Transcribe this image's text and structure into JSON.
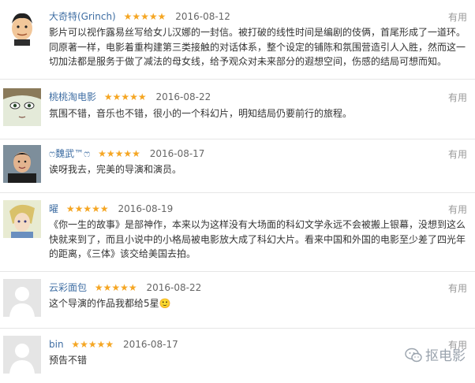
{
  "reviews": [
    {
      "username": "大奇特(Grinch)",
      "stars": "★★★★★",
      "date": "2016-08-12",
      "useful": "有用",
      "content": "影片可以视作露易丝写给女儿汉娜的一封信。被打破的线性时间是编剧的伎俩，首尾形成了一道环。同原著一样，电影着重构建第三类接触的对话体系，整个设定的铺陈和氛围营造引人入胜，然而这一切加法都是服务于做了减法的母女线，给予观众对未来部分的遐想空间，伤感的结局可想而知。"
    },
    {
      "username": "桃桃淘电影",
      "stars": "★★★★★",
      "date": "2016-08-22",
      "useful": "有用",
      "content": "氛围不错，音乐也不错，很小的一个科幻片，明知结局仍要前行的旅程。"
    },
    {
      "username": "ෆ魏武™ෆ",
      "stars": "★★★★★",
      "date": "2016-08-17",
      "useful": "有用",
      "content": "诶呀我去，完美的导演和演员。"
    },
    {
      "username": "曜",
      "stars": "★★★★★",
      "date": "2016-08-19",
      "useful": "有用",
      "content": "《你一生的故事》是部神作，本来以为这样没有大场面的科幻文学永远不会被搬上银幕，没想到这么快就来到了，而且小说中的小格局被电影放大成了科幻大片。看来中国和外国的电影至少差了四光年的距离，《三体》该交给美国去拍。"
    },
    {
      "username": "云彩面包",
      "stars": "★★★★★",
      "date": "2016-08-22",
      "useful": "有用",
      "content": "这个导演的作品我都给5星🙂"
    },
    {
      "username": "bin",
      "stars": "★★★★★",
      "date": "2016-08-17",
      "useful": "有用",
      "content": "预告不错"
    }
  ],
  "watermark": "抠电影",
  "colors": {
    "username": "#3f6ea3",
    "star": "#f5a623",
    "date": "#666666",
    "useful": "#999999"
  }
}
